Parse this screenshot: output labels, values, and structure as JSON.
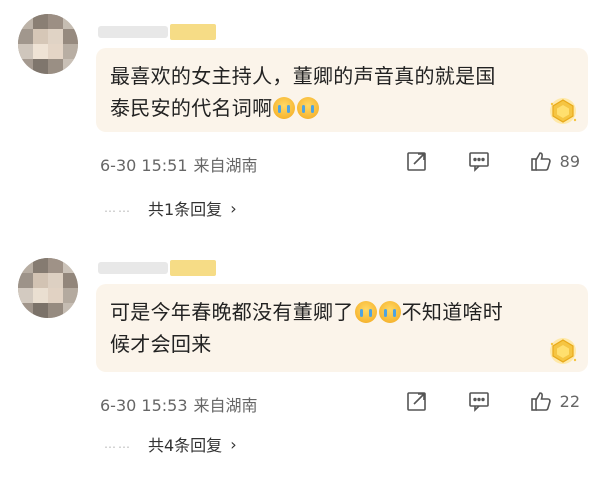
{
  "comments": [
    {
      "text_line1": "最喜欢的女主持人，董卿的声音真的就是国",
      "text_line2": "泰民安的代名词啊",
      "emoji_count_in_line2": 2,
      "timestamp": "6-30 15:51",
      "location": "来自湖南",
      "likes": "89",
      "replies_label": "共1条回复",
      "reply_dots": "……",
      "chevron": "›"
    },
    {
      "text_line1": "可是今年春晚都没有董卿了",
      "text_line1_after": "不知道啥时",
      "text_line2": "候才会回来",
      "timestamp": "6-30 15:53",
      "location": "来自湖南",
      "likes": "22",
      "replies_label": "共4条回复",
      "reply_dots": "……",
      "chevron": "›"
    }
  ],
  "icons": {
    "emoji": "crying-face-icon",
    "badge": "gold-badge-icon",
    "share": "share-icon",
    "comment": "comment-icon",
    "like": "thumbs-up-icon"
  },
  "colors": {
    "bubble": "#fbf4ea",
    "name_tag": "#f6dc86",
    "meta_text": "#666666"
  }
}
